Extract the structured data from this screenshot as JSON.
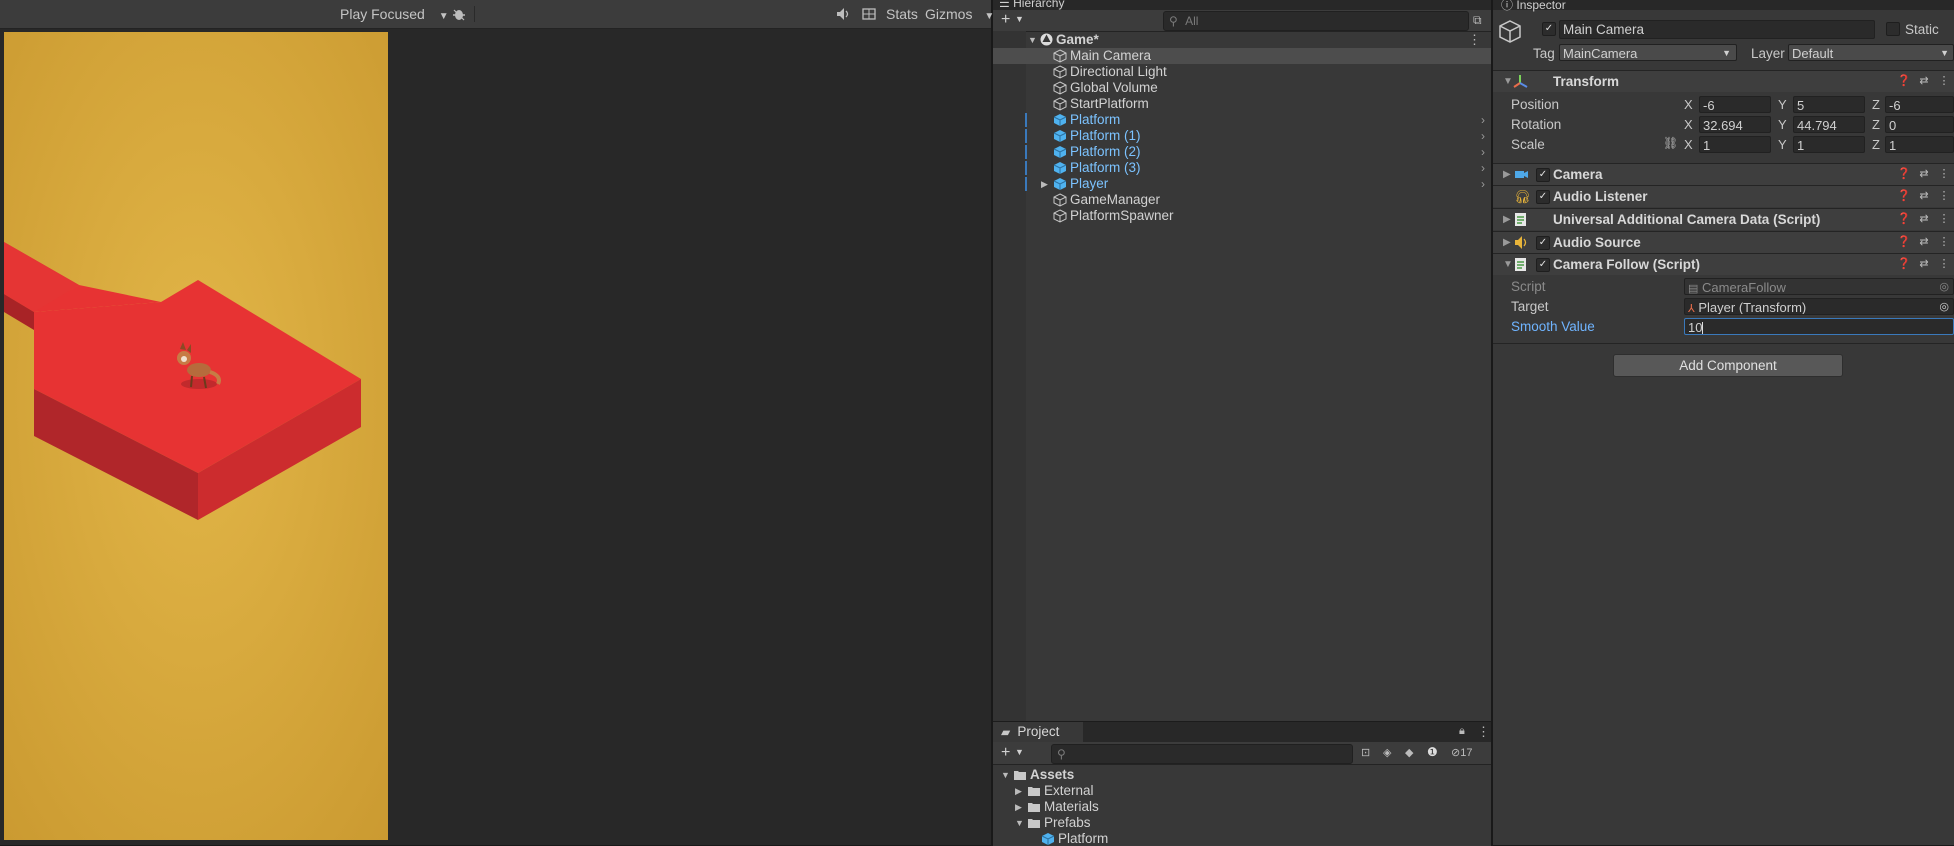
{
  "game_toolbar": {
    "play_mode": "Play Focused",
    "stats": "Stats",
    "gizmos": "Gizmos"
  },
  "hierarchy": {
    "tab": "Hierarchy",
    "search_placeholder": "All",
    "scene": "Game*",
    "items": [
      {
        "label": "Main Camera"
      },
      {
        "label": "Directional Light"
      },
      {
        "label": "Global Volume"
      },
      {
        "label": "StartPlatform"
      },
      {
        "label": "Platform"
      },
      {
        "label": "Platform (1)"
      },
      {
        "label": "Platform (2)"
      },
      {
        "label": "Platform (3)"
      },
      {
        "label": "Player"
      },
      {
        "label": "GameManager"
      },
      {
        "label": "PlatformSpawner"
      }
    ]
  },
  "project": {
    "tab": "Project",
    "hidden_count": "17",
    "tree": [
      {
        "label": "Assets"
      },
      {
        "label": "External"
      },
      {
        "label": "Materials"
      },
      {
        "label": "Prefabs"
      },
      {
        "label": "Platform"
      }
    ]
  },
  "inspector": {
    "tab": "Inspector",
    "object_name": "Main Camera",
    "static_label": "Static",
    "tag_label": "Tag",
    "tag_value": "MainCamera",
    "layer_label": "Layer",
    "layer_value": "Default",
    "transform": {
      "title": "Transform",
      "position_label": "Position",
      "rotation_label": "Rotation",
      "scale_label": "Scale",
      "position": {
        "x": "-6",
        "y": "5",
        "z": "-6"
      },
      "rotation": {
        "x": "32.694",
        "y": "44.794",
        "z": "0"
      },
      "scale": {
        "x": "1",
        "y": "1",
        "z": "1"
      }
    },
    "axis_x": "X",
    "axis_y": "Y",
    "axis_z": "Z",
    "components": [
      {
        "name": "Camera"
      },
      {
        "name": "Audio Listener"
      },
      {
        "name": "Universal Additional Camera Data (Script)"
      },
      {
        "name": "Audio Source"
      },
      {
        "name": "Camera Follow (Script)"
      }
    ],
    "camera_follow": {
      "script_label": "Script",
      "script_value": "CameraFollow",
      "target_label": "Target",
      "target_value": "Player (Transform)",
      "smooth_label": "Smooth Value",
      "smooth_value": "10"
    },
    "add_component": "Add Component"
  },
  "colors": {
    "game_background": "#d8a93c",
    "platform_red": "#e3302f",
    "selection_blue": "#7cc3ff"
  }
}
